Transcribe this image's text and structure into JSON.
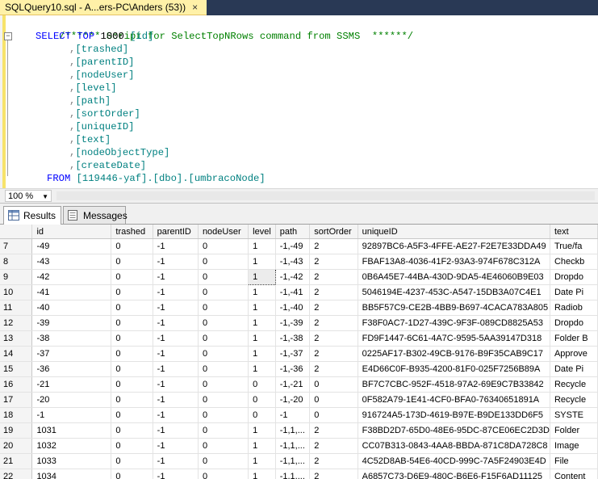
{
  "tab": {
    "title": "SQLQuery10.sql - A...ers-PC\\Anders (53))",
    "close_glyph": "×"
  },
  "editor": {
    "comment": "/****** Script for SelectTopNRows command from SSMS  ******/",
    "select_kw": "SELECT",
    "top_kw": "TOP",
    "top_num": "1000",
    "first_col": "[id]",
    "columns": [
      "[trashed]",
      "[parentID]",
      "[nodeUser]",
      "[level]",
      "[path]",
      "[sortOrder]",
      "[uniqueID]",
      "[text]",
      "[nodeObjectType]",
      "[createDate]"
    ],
    "from_kw": "FROM",
    "from_target": "[119446-yaf].[dbo].[umbracoNode]"
  },
  "zoom": {
    "value": "100 %"
  },
  "results_tabs": [
    {
      "label": "Results",
      "icon": "grid-icon"
    },
    {
      "label": "Messages",
      "icon": "messages-icon"
    }
  ],
  "grid": {
    "headers": [
      "id",
      "trashed",
      "parentID",
      "nodeUser",
      "level",
      "path",
      "sortOrder",
      "uniqueID",
      "text"
    ],
    "rows": [
      [
        "7",
        "-49",
        "0",
        "-1",
        "0",
        "1",
        "-1,-49",
        "2",
        "92897BC6-A5F3-4FFE-AE27-F2E7E33DDA49",
        "True/fa"
      ],
      [
        "8",
        "-43",
        "0",
        "-1",
        "0",
        "1",
        "-1,-43",
        "2",
        "FBAF13A8-4036-41F2-93A3-974F678C312A",
        "Checkb"
      ],
      [
        "9",
        "-42",
        "0",
        "-1",
        "0",
        "1",
        "-1,-42",
        "2",
        "0B6A45E7-44BA-430D-9DA5-4E46060B9E03",
        "Dropdo"
      ],
      [
        "10",
        "-41",
        "0",
        "-1",
        "0",
        "1",
        "-1,-41",
        "2",
        "5046194E-4237-453C-A547-15DB3A07C4E1",
        "Date Pi"
      ],
      [
        "11",
        "-40",
        "0",
        "-1",
        "0",
        "1",
        "-1,-40",
        "2",
        "BB5F57C9-CE2B-4BB9-B697-4CACA783A805",
        "Radiob"
      ],
      [
        "12",
        "-39",
        "0",
        "-1",
        "0",
        "1",
        "-1,-39",
        "2",
        "F38F0AC7-1D27-439C-9F3F-089CD8825A53",
        "Dropdo"
      ],
      [
        "13",
        "-38",
        "0",
        "-1",
        "0",
        "1",
        "-1,-38",
        "2",
        "FD9F1447-6C61-4A7C-9595-5AA39147D318",
        "Folder B"
      ],
      [
        "14",
        "-37",
        "0",
        "-1",
        "0",
        "1",
        "-1,-37",
        "2",
        "0225AF17-B302-49CB-9176-B9F35CAB9C17",
        "Approve"
      ],
      [
        "15",
        "-36",
        "0",
        "-1",
        "0",
        "1",
        "-1,-36",
        "2",
        "E4D66C0F-B935-4200-81F0-025F7256B89A",
        "Date Pi"
      ],
      [
        "16",
        "-21",
        "0",
        "-1",
        "0",
        "0",
        "-1,-21",
        "0",
        "BF7C7CBC-952F-4518-97A2-69E9C7B33842",
        "Recycle"
      ],
      [
        "17",
        "-20",
        "0",
        "-1",
        "0",
        "0",
        "-1,-20",
        "0",
        "0F582A79-1E41-4CF0-BFA0-76340651891A",
        "Recycle"
      ],
      [
        "18",
        "-1",
        "0",
        "-1",
        "0",
        "0",
        "-1",
        "0",
        "916724A5-173D-4619-B97E-B9DE133DD6F5",
        "SYSTE"
      ],
      [
        "19",
        "1031",
        "0",
        "-1",
        "0",
        "1",
        "-1,1,...",
        "2",
        "F38BD2D7-65D0-48E6-95DC-87CE06EC2D3D",
        "Folder"
      ],
      [
        "20",
        "1032",
        "0",
        "-1",
        "0",
        "1",
        "-1,1,...",
        "2",
        "CC07B313-0843-4AA8-BBDA-871C8DA728C8",
        "Image"
      ],
      [
        "21",
        "1033",
        "0",
        "-1",
        "0",
        "1",
        "-1,1,...",
        "2",
        "4C52D8AB-54E6-40CD-999C-7A5F24903E4D",
        "File"
      ],
      [
        "22",
        "1034",
        "0",
        "-1",
        "0",
        "1",
        "-1,1,...",
        "2",
        "A6857C73-D6E9-480C-B6E6-F15F6AD11125",
        "Content"
      ]
    ]
  }
}
